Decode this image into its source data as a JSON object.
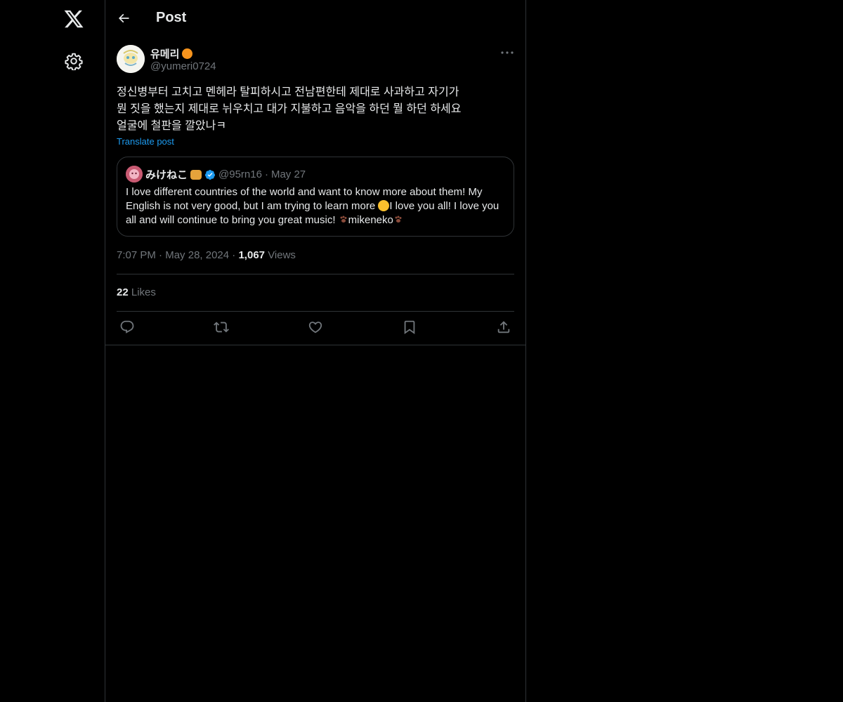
{
  "header": {
    "title": "Post"
  },
  "post": {
    "author_name": "유메리",
    "author_handle": "@yumeri0724",
    "text": "정신병부터 고치고 멘헤라 탈피하시고 전남편한테 제대로 사과하고 자기가\n뭔 짓을 했는지 제대로 뉘우치고 대가 지불하고 음악을 하던 뭘 하던 하세요\n얼굴에 철판을 깔았나ㅋ",
    "translate_label": "Translate post",
    "time": "7:07 PM",
    "date": "May 28, 2024",
    "views_count": "1,067",
    "views_label": "Views",
    "likes_count": "22",
    "likes_label": "Likes"
  },
  "quote": {
    "author_name": "みけねこ",
    "author_handle": "@95rn16",
    "date": "May 27",
    "text_part1": "I love different countries of the world and want to know more about them! My English is not very good, but I am trying to learn more ",
    "text_part2": "I love you all! I love you all and will continue to bring you great music! ",
    "text_part3": "mikeneko"
  },
  "separators": {
    "dot": "·"
  },
  "colors": {
    "background": "#000000",
    "accent": "#1d9bf0",
    "muted": "#71767b",
    "text": "#e7e9ea",
    "border": "#2f3336"
  },
  "icons": [
    "x-logo-icon",
    "settings-gear-icon",
    "back-arrow-icon",
    "more-dots-icon",
    "verified-badge-icon",
    "reply-icon",
    "repost-icon",
    "like-heart-icon",
    "bookmark-icon",
    "share-icon"
  ]
}
